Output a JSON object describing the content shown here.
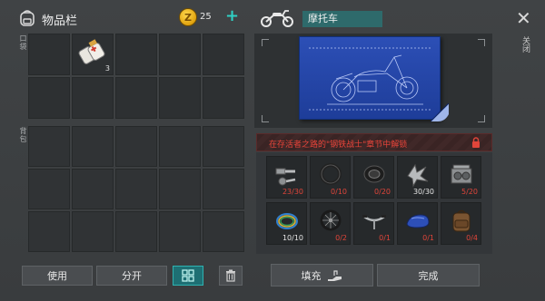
{
  "header": {
    "title": "物品栏",
    "coin_symbol": "Z",
    "coin_count": "25",
    "coin_plus": "+"
  },
  "inventory": {
    "pocket_label": "口袋",
    "backpack_label": "背包",
    "pocket_item": {
      "icon": "bandage-roll-icon",
      "qty": "3"
    }
  },
  "left_buttons": {
    "use": "使用",
    "split": "分开",
    "grid_icon": "grid-view-icon",
    "trash_icon": "trash-icon"
  },
  "craft": {
    "vehicle_icon": "motorcycle-icon",
    "name": "摩托车",
    "close_symbol": "✕",
    "close_label": "关闭",
    "unlock_text": "在存活者之路的\"钢铁战士\"章节中解锁",
    "materials": [
      {
        "icon": "bolts-screws-icon",
        "count": "23/30",
        "status": "insufficient"
      },
      {
        "icon": "rubber-ring-icon",
        "count": "0/10",
        "status": "insufficient"
      },
      {
        "icon": "tire-icon",
        "count": "0/20",
        "status": "insufficient"
      },
      {
        "icon": "metal-scrap-icon",
        "count": "30/30",
        "status": "complete"
      },
      {
        "icon": "engine-block-icon",
        "count": "5/20",
        "status": "insufficient"
      },
      {
        "icon": "wire-coil-icon",
        "count": "10/10",
        "status": "complete"
      },
      {
        "icon": "spoked-wheel-icon",
        "count": "0/2",
        "status": "insufficient"
      },
      {
        "icon": "handlebar-icon",
        "count": "0/1",
        "status": "insufficient"
      },
      {
        "icon": "fuel-tank-icon",
        "count": "0/1",
        "status": "insufficient"
      },
      {
        "icon": "leather-seat-bag-icon",
        "count": "0/4",
        "status": "insufficient"
      }
    ],
    "fill_label": "填充",
    "done_label": "完成"
  },
  "colors": {
    "accent_teal": "#2fb2b0",
    "warning_red": "#e0453a",
    "blueprint_blue": "#2c4fb6"
  }
}
